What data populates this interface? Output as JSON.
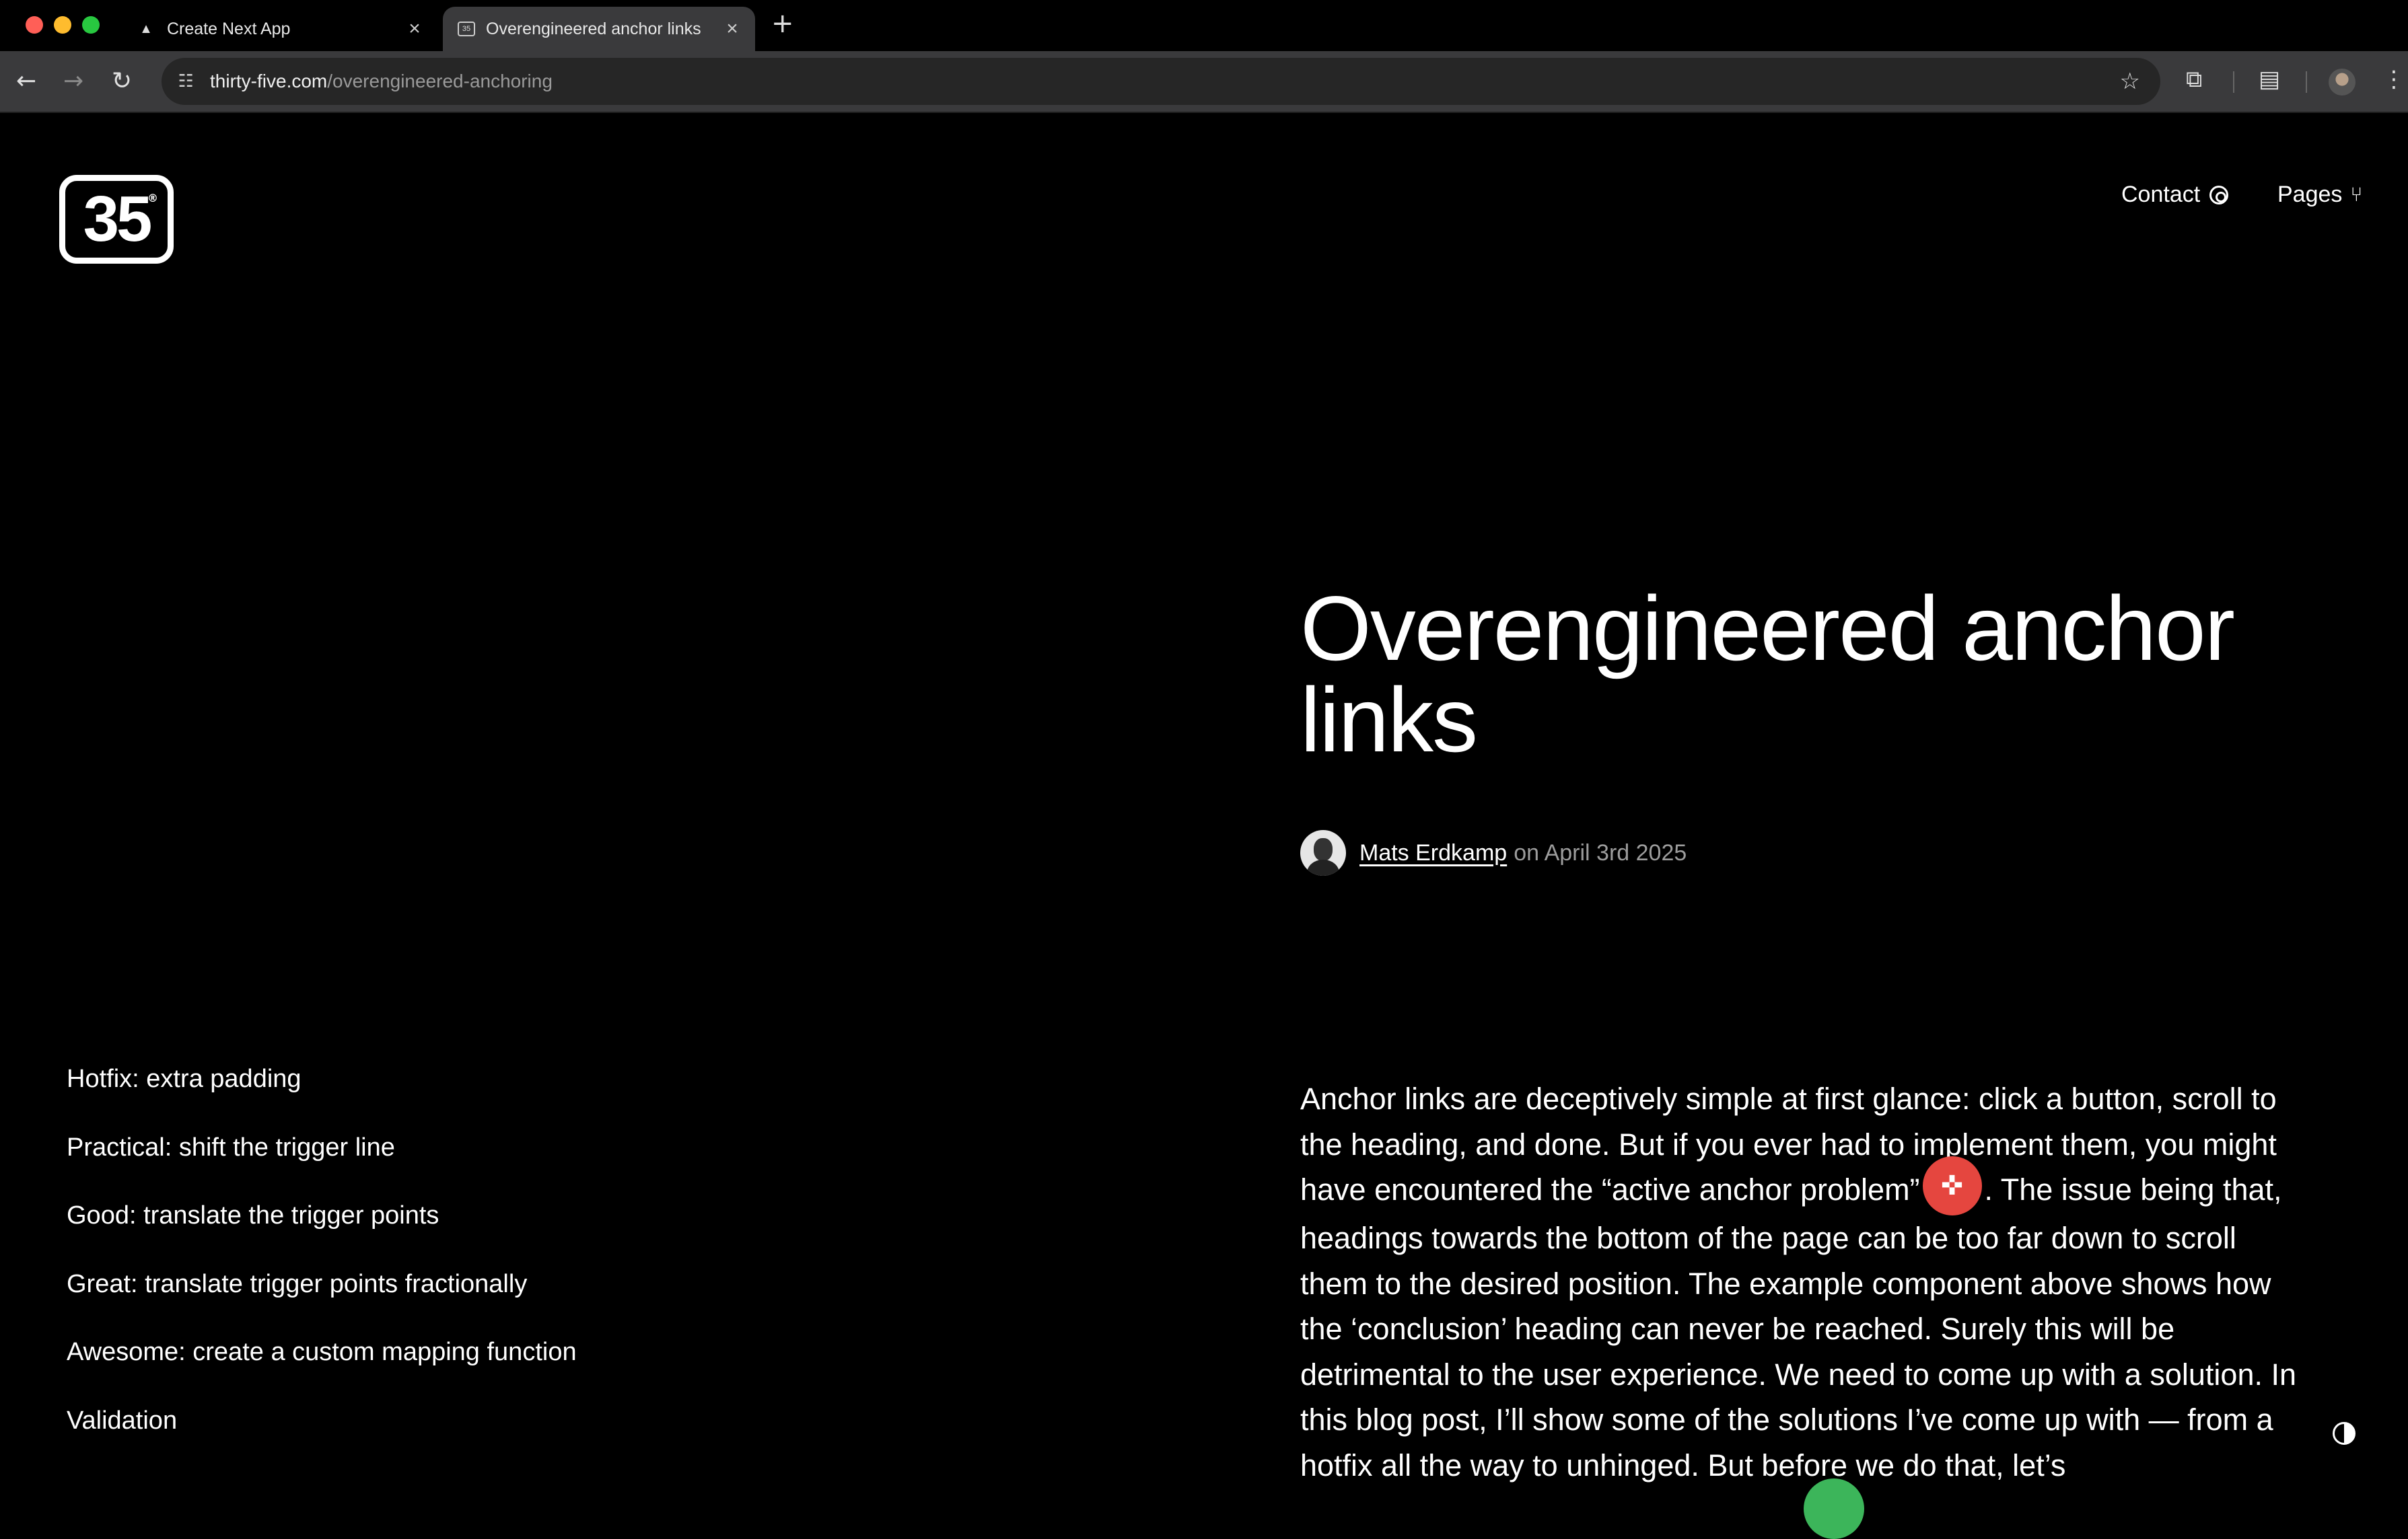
{
  "browser": {
    "tabs": [
      {
        "title": "Create Next App",
        "icon": "triangle-icon",
        "active": false
      },
      {
        "title": "Overengineered anchor links",
        "icon": "site-favicon-icon",
        "active": true
      }
    ],
    "url_host": "thirty-five.com",
    "url_path": "/overengineered-anchoring"
  },
  "site": {
    "logo_text": "35",
    "logo_reg": "®",
    "nav": {
      "contact_label": "Contact",
      "pages_label": "Pages"
    }
  },
  "article": {
    "title": "Overengineered anchor links",
    "author": "Mats Erdkamp",
    "date_text": "on April 3rd 2025",
    "body_before_badge": "Anchor links are deceptively simple at first glance: click a button, scroll to the heading, and done. But if you ever had to implement them, you might have encountered the “active anchor problem”",
    "body_after_badge": ". The issue being that, headings towards the bottom of the page can be too far down to scroll them to the desired position. The example component above shows how the ‘conclusion’ heading can never be reached. Surely this will be detrimental to the user experience. We need to come up with a solution. In this blog post, I’ll show some of the solutions I’ve come up with — from a hotfix all the way to unhinged. But before we do that, let’s"
  },
  "toc": [
    "Hotfix: extra padding",
    "Practical: shift the trigger line",
    "Good: translate the trigger points",
    "Great: translate trigger points fractionally",
    "Awesome: create a custom mapping function",
    "Validation"
  ],
  "colors": {
    "background": "#000000",
    "text": "#ffffff",
    "muted": "#9c9c9c",
    "badge_red": "#e5463f",
    "badge_green": "#3cb55a"
  }
}
